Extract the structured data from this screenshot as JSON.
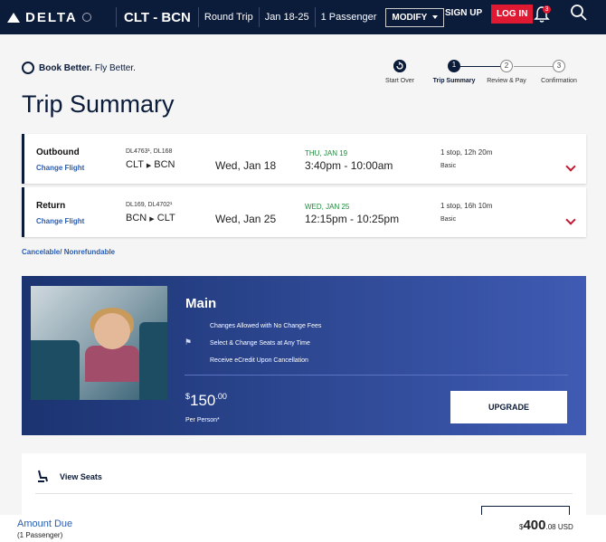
{
  "nav": {
    "brand": "DELTA",
    "route": "CLT - BCN",
    "trip_type": "Round Trip",
    "dates": "Jan 18-25",
    "passengers": "1 Passenger",
    "modify": "MODIFY",
    "signup": "SIGN UP",
    "login": "LOG IN",
    "notification_count": "3"
  },
  "header": {
    "tag_bold": "Book Better.",
    "tag_rest": "Fly Better.",
    "title": "Trip Summary"
  },
  "steps": [
    {
      "label": "Start Over",
      "num": ""
    },
    {
      "label": "Trip Summary",
      "num": "1"
    },
    {
      "label": "Review & Pay",
      "num": "2"
    },
    {
      "label": "Confirmation",
      "num": "3"
    }
  ],
  "flights": [
    {
      "direction": "Outbound",
      "change": "Change Flight",
      "flight_numbers": "DL4763¹, DL168",
      "origin": "CLT",
      "destination": "BCN",
      "date": "Wed, Jan 18",
      "arrival_date": "THU, JAN 19",
      "times": "3:40pm - 10:00am",
      "stops": "1 stop, 12h 20m",
      "fare": "Basic"
    },
    {
      "direction": "Return",
      "change": "Change Flight",
      "flight_numbers": "DL169, DL4702¹",
      "origin": "BCN",
      "destination": "CLT",
      "date": "Wed, Jan 25",
      "arrival_date": "WED, JAN 25",
      "times": "12:15pm - 10:25pm",
      "stops": "1 stop, 16h 10m",
      "fare": "Basic"
    }
  ],
  "cancel_note": "Cancelable/ Nonrefundable",
  "cabin": {
    "title": "Main",
    "features": [
      "Changes Allowed with No Change Fees",
      "Select & Change Seats at Any Time",
      "Receive eCredit Upon Cancellation"
    ],
    "price_currency": "$",
    "price_whole": "150",
    "price_cents": ".00",
    "per_person": "Per Person*",
    "upgrade": "UPGRADE"
  },
  "seats": {
    "label": "View Seats"
  },
  "footer": {
    "amount_due": "Amount Due",
    "passengers": "(1 Passenger)",
    "total_currency": "$",
    "total_whole": "400",
    "total_cents": ".08 USD"
  },
  "colors": {
    "navy": "#0b1b3a",
    "red": "#e01933",
    "link": "#2a5db0",
    "green": "#1e8a3c"
  }
}
